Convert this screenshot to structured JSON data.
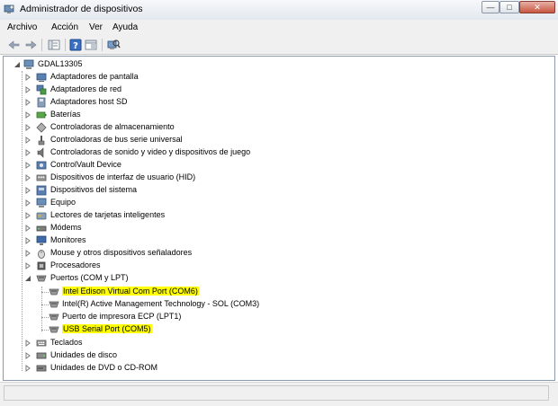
{
  "window": {
    "title": "Administrador de dispositivos",
    "minimize_glyph": "—",
    "maximize_glyph": "□",
    "close_glyph": "✕"
  },
  "menu": [
    "Archivo",
    "Acción",
    "Ver",
    "Ayuda"
  ],
  "toolbar": [
    "back-arrow-icon",
    "forward-arrow-icon",
    "properties-panel-icon",
    "help-icon",
    "view-panel-icon",
    "scan-hardware-icon"
  ],
  "tree": {
    "root": {
      "label": "GDAL13305",
      "expanded": true,
      "icon": "computer-icon"
    },
    "items": [
      {
        "label": "Adaptadores de pantalla",
        "icon": "display-adapter-icon"
      },
      {
        "label": "Adaptadores de red",
        "icon": "network-adapter-icon"
      },
      {
        "label": "Adaptadores host SD",
        "icon": "sd-host-icon"
      },
      {
        "label": "Baterías",
        "icon": "battery-icon"
      },
      {
        "label": "Controladoras de almacenamiento",
        "icon": "storage-controller-icon"
      },
      {
        "label": "Controladoras de bus serie universal",
        "icon": "usb-controller-icon"
      },
      {
        "label": "Controladoras de sonido y video y dispositivos de juego",
        "icon": "sound-icon"
      },
      {
        "label": "ControlVault Device",
        "icon": "controlvault-icon"
      },
      {
        "label": "Dispositivos de interfaz de usuario (HID)",
        "icon": "hid-icon"
      },
      {
        "label": "Dispositivos del sistema",
        "icon": "system-device-icon"
      },
      {
        "label": "Equipo",
        "icon": "equipment-icon"
      },
      {
        "label": "Lectores de tarjetas inteligentes",
        "icon": "smart-card-icon"
      },
      {
        "label": "Módems",
        "icon": "modem-icon"
      },
      {
        "label": "Monitores",
        "icon": "monitor-icon"
      },
      {
        "label": "Mouse y otros dispositivos señaladores",
        "icon": "mouse-icon"
      },
      {
        "label": "Procesadores",
        "icon": "processor-icon"
      },
      {
        "label": "Puertos (COM y LPT)",
        "icon": "port-icon",
        "expanded": true,
        "children": [
          {
            "label": "Intel Edison Virtual Com Port (COM6)",
            "highlight": true
          },
          {
            "label": "Intel(R) Active Management Technology - SOL (COM3)",
            "highlight": false
          },
          {
            "label": "Puerto de impresora ECP (LPT1)",
            "highlight": false
          },
          {
            "label": "USB Serial Port (COM5)",
            "highlight": true
          }
        ]
      },
      {
        "label": "Teclados",
        "icon": "keyboard-icon"
      },
      {
        "label": "Unidades de disco",
        "icon": "disk-drive-icon"
      },
      {
        "label": "Unidades de DVD o CD-ROM",
        "icon": "dvd-icon"
      }
    ]
  },
  "colors": {
    "highlight": "#ffff00",
    "expander": "#7a7a7a",
    "selection_accent": "#3399ff"
  }
}
